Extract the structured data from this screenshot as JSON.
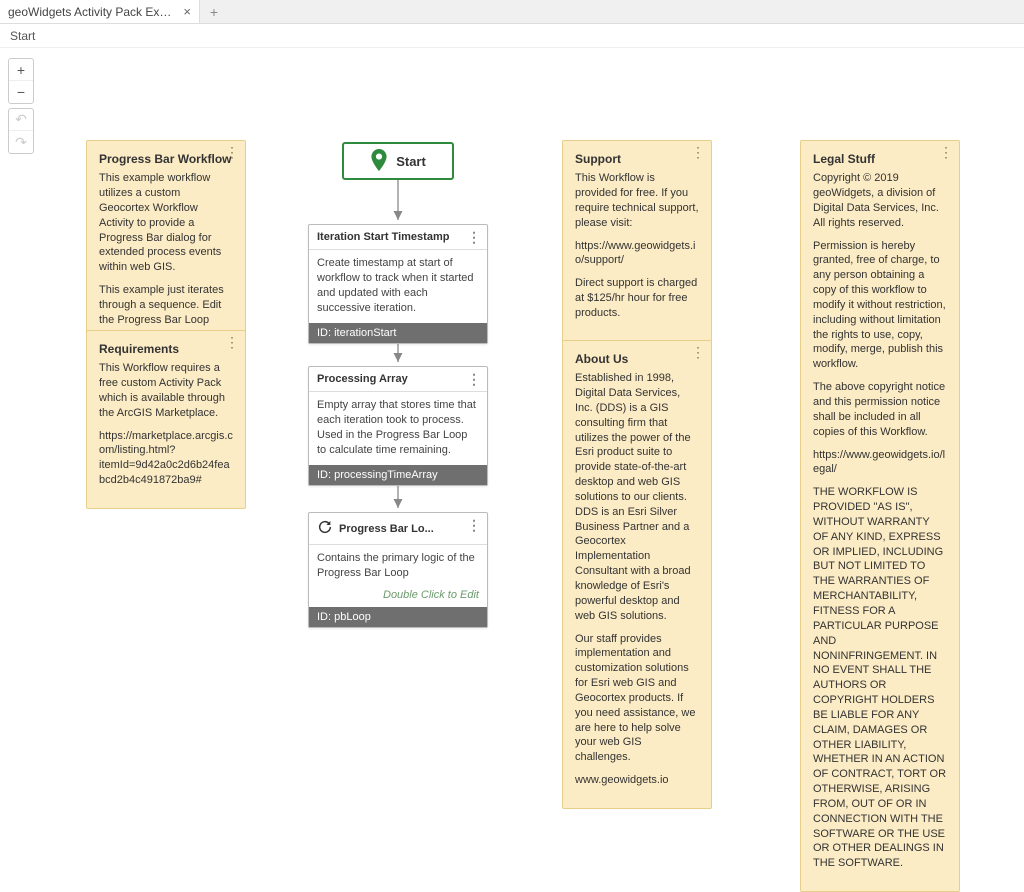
{
  "tab": {
    "title": "geoWidgets Activity Pack Exam..."
  },
  "toolbar": {
    "start": "Start"
  },
  "flow": {
    "start_label": "Start",
    "nodes": [
      {
        "title": "Iteration Start Timestamp",
        "desc": "Create timestamp at start of workflow to track when it started and updated with each successive iteration.",
        "id_label": "ID: iterationStart"
      },
      {
        "title": "Processing Array",
        "desc": "Empty array that stores time that each iteration took to process. Used in the Progress Bar Loop to calculate time remaining.",
        "id_label": "ID: processingTimeArray"
      },
      {
        "title": "Progress Bar Lo...",
        "desc": "Contains the primary logic of the Progress Bar Loop",
        "hint": "Double Click to Edit",
        "id_label": "ID: pbLoop"
      }
    ]
  },
  "stickies": {
    "workflow": {
      "title": "Progress Bar Workflow",
      "p1": "This example workflow utilizes a custom Geocortex Workflow Activity to provide a Progress Bar dialog for extended process events within web GIS.",
      "p2": "This example just iterates through a sequence. Edit the Progress Bar Loop"
    },
    "requirements": {
      "title": "Requirements",
      "p1": "This Workflow requires a free custom Activity Pack which is available through the ArcGIS Marketplace.",
      "p2": "https://marketplace.arcgis.com/listing.html?itemId=9d42a0c2d6b24feabcd2b4c491872ba9#"
    },
    "support": {
      "title": "Support",
      "p1": "This Workflow is provided for free. If you require technical support, please visit:",
      "p2": "https://www.geowidgets.io/support/",
      "p3": "Direct support is charged at $125/hr hour for free products."
    },
    "about": {
      "title": "About Us",
      "p1": "Established in 1998, Digital Data Services, Inc. (DDS) is a GIS consulting firm that utilizes the power of the Esri product suite to provide state-of-the-art desktop and web GIS solutions to our clients. DDS is an Esri Silver Business Partner and a Geocortex Implementation Consultant with a broad knowledge of Esri's powerful desktop and web GIS solutions.",
      "p2": "Our staff provides implementation and customization solutions for Esri web GIS and Geocortex products. If you need assistance, we are here to help solve your web GIS challenges.",
      "p3": "www.geowidgets.io"
    },
    "legal": {
      "title": "Legal Stuff",
      "p1": "Copyright © 2019 geoWidgets, a division of Digital Data Services, Inc. All rights reserved.",
      "p2": "Permission is hereby granted, free of charge, to any person obtaining a copy of this workflow to modify it without restriction, including without limitation the rights to use, copy, modify, merge, publish this workflow.",
      "p3": "The above copyright notice and this permission notice shall be included in all copies of this Workflow.",
      "p4": "https://www.geowidgets.io/legal/",
      "p5": "THE WORKFLOW IS PROVIDED \"AS IS\", WITHOUT WARRANTY OF ANY KIND, EXPRESS OR IMPLIED, INCLUDING BUT NOT LIMITED TO THE WARRANTIES OF MERCHANTABILITY, FITNESS FOR A PARTICULAR PURPOSE AND NONINFRINGEMENT. IN NO EVENT SHALL THE AUTHORS OR COPYRIGHT HOLDERS BE LIABLE FOR ANY CLAIM, DAMAGES OR OTHER LIABILITY, WHETHER IN AN ACTION OF CONTRACT, TORT OR OTHERWISE, ARISING FROM, OUT OF OR IN CONNECTION WITH THE SOFTWARE OR THE USE OR OTHER DEALINGS IN THE SOFTWARE."
    }
  }
}
